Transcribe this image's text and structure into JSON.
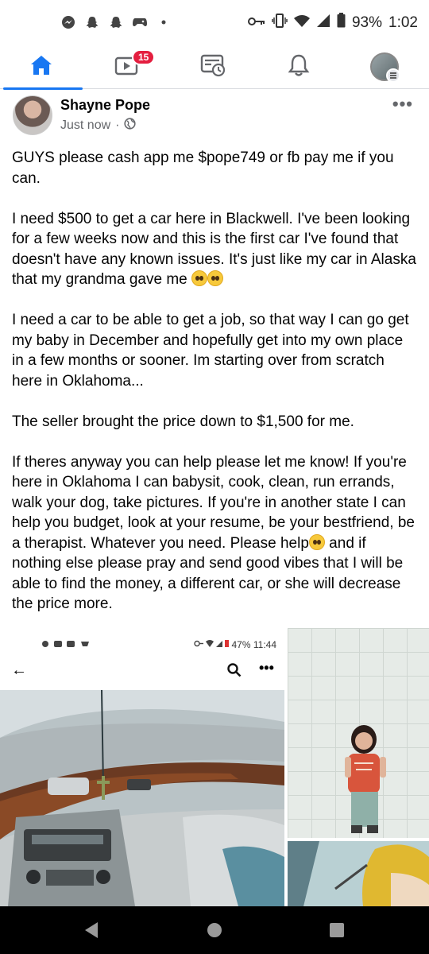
{
  "status_bar": {
    "battery": "93%",
    "time": "1:02",
    "left_icons": [
      "messenger-icon",
      "snapchat-icon",
      "snapchat-icon",
      "game-controller-icon",
      "dot-icon"
    ],
    "right_icons": [
      "key-icon",
      "vibrate-icon",
      "wifi-icon",
      "signal-icon",
      "battery-icon"
    ]
  },
  "nav": {
    "tabs": [
      "home-icon",
      "watch-icon",
      "news-feed-icon",
      "notifications-icon",
      "profile-menu-icon"
    ],
    "watch_badge": "15",
    "accent": "#1877f2"
  },
  "post": {
    "author": "Shayne Pope",
    "timestamp": "Just now",
    "audience_separator": "·",
    "paragraphs": [
      "GUYS please cash app me $pope749 or fb pay me if you can.",
      "I need $500 to get a car here in Blackwell. I've been looking for a few weeks now and this is the first car I've found that doesn't have any known issues. It's just like my car in Alaska that my grandma gave me",
      "I need a car to be able to get a job, so that way I can go get my baby in December and hopefully get into my own place in a few months or sooner. Im starting over from scratch here in Oklahoma...",
      "The seller brought the price down to $1,500 for me.",
      "If theres anyway you can help please let me know! If you're here in Oklahoma I can babysit, cook, clean, run errands, walk your dog, take pictures. If you're in another state I can help you budget, look at your resume, be your bestfriend, be a therapist. Whatever you need. Please help",
      " and if nothing else please pray and send good vibes that I will be able to find the money, a different car, or she will decrease the price more."
    ]
  },
  "photo": {
    "inner_battery": "47%",
    "inner_time": "11:44"
  }
}
